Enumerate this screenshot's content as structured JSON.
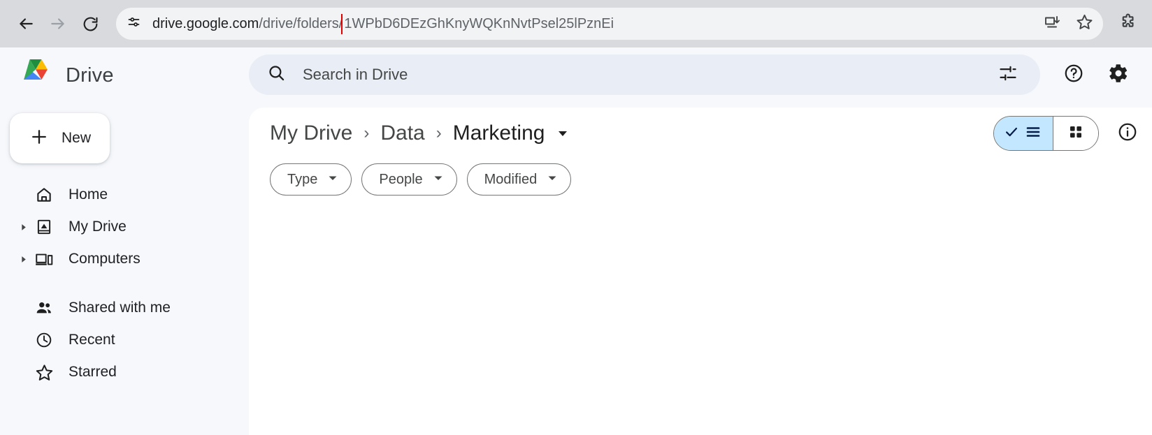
{
  "browser": {
    "back_icon": "arrow-left-icon",
    "forward_icon": "arrow-right-icon",
    "reload_icon": "reload-icon",
    "site_info_icon": "site-settings-icon",
    "url_domain": "drive.google.com",
    "url_path": "/drive/folders/",
    "url_folder_id": "1WPbD6DEzGhKnyWQKnNvtPsel25lPznEi",
    "highlight_color": "#e10000",
    "install_icon": "install-app-icon",
    "bookmark_icon": "star-icon",
    "extensions_icon": "puzzle-piece-icon"
  },
  "sidebar": {
    "brand": "Drive",
    "logo_icon": "google-drive-logo",
    "new_button": {
      "label": "New",
      "icon": "plus-icon"
    },
    "items": [
      {
        "label": "Home",
        "icon": "home-icon",
        "expandable": false
      },
      {
        "label": "My Drive",
        "icon": "my-drive-icon",
        "expandable": true
      },
      {
        "label": "Computers",
        "icon": "computers-icon",
        "expandable": true
      },
      {
        "label": "Shared with me",
        "icon": "people-icon",
        "expandable": false
      },
      {
        "label": "Recent",
        "icon": "clock-icon",
        "expandable": false
      },
      {
        "label": "Starred",
        "icon": "star-outline-icon",
        "expandable": false
      }
    ]
  },
  "header": {
    "search_placeholder": "Search in Drive",
    "search_icon": "search-icon",
    "tune_icon": "tune-filter-icon",
    "help_icon": "help-circle-icon",
    "settings_icon": "gear-icon"
  },
  "breadcrumb": {
    "items": [
      "My Drive",
      "Data",
      "Marketing"
    ],
    "separator": "›",
    "caret_icon": "caret-down-icon"
  },
  "toolbar": {
    "view_list_label": "list-view",
    "view_grid_label": "grid-view",
    "active_view": "list",
    "check_icon": "check-icon",
    "list_icon": "list-view-icon",
    "grid_icon": "grid-view-icon",
    "info_icon": "info-circle-icon",
    "active_bg": "#c2e7ff"
  },
  "filters": [
    {
      "label": "Type",
      "icon": "caret-down-icon"
    },
    {
      "label": "People",
      "icon": "caret-down-icon"
    },
    {
      "label": "Modified",
      "icon": "caret-down-icon"
    }
  ]
}
